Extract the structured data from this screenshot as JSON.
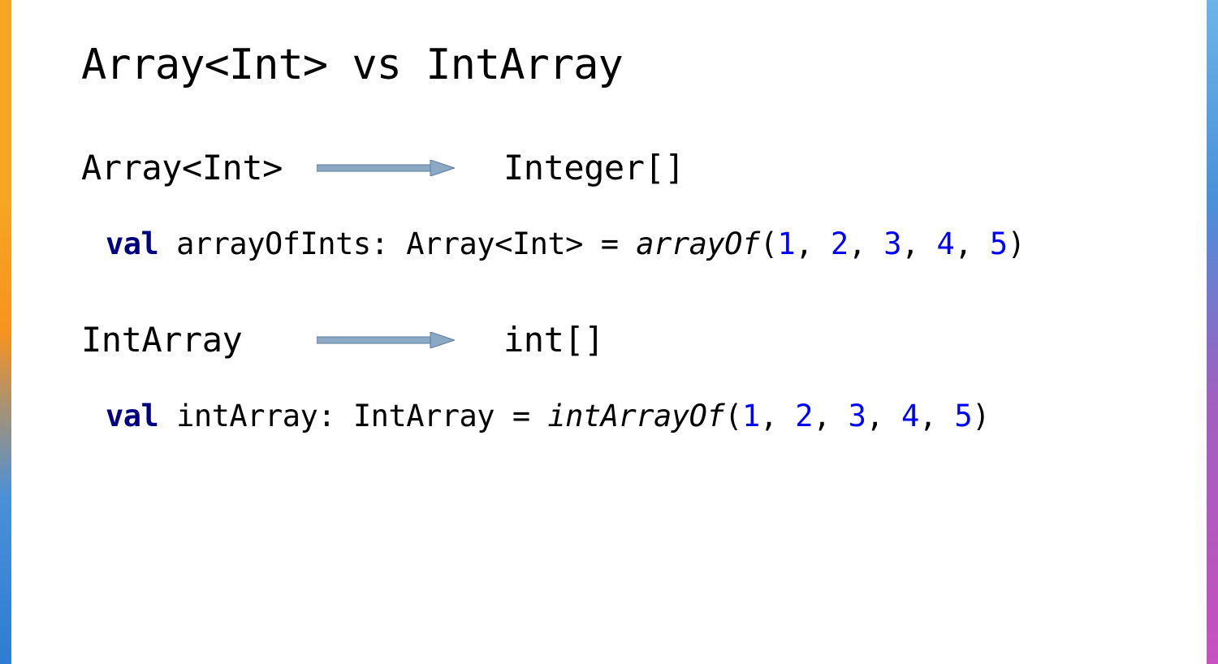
{
  "slide": {
    "title": "Array<Int> vs IntArray",
    "section1": {
      "kotlin_type": "Array<Int>",
      "java_type": "Integer[]",
      "code": {
        "keyword": "val",
        "varname": " arrayOfInts: Array<Int> = ",
        "fn": "arrayOf",
        "open": "(",
        "n1": "1",
        "c1": ", ",
        "n2": "2",
        "c2": ", ",
        "n3": "3",
        "c3": ", ",
        "n4": "4",
        "c4": ", ",
        "n5": "5",
        "close": ")"
      }
    },
    "section2": {
      "kotlin_type": "IntArray",
      "java_type": "int[]",
      "code": {
        "keyword": "val",
        "varname": " intArray: IntArray = ",
        "fn": "intArrayOf",
        "open": "(",
        "n1": "1",
        "c1": ", ",
        "n2": "2",
        "c2": ", ",
        "n3": "3",
        "c3": ", ",
        "n4": "4",
        "c4": ", ",
        "n5": "5",
        "close": ")"
      }
    }
  },
  "colors": {
    "arrow_fill": "#8ba9c5",
    "arrow_stroke": "#5a7a9a"
  }
}
